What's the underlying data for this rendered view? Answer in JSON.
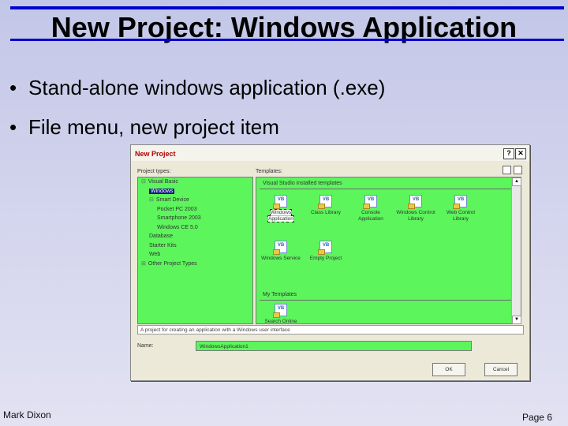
{
  "slide": {
    "title": "New Project: Windows Application",
    "bullets": [
      "Stand-alone windows application (.exe)",
      "File menu, new project item"
    ],
    "bullet_glyph": "•",
    "footer_left": "Mark Dixon",
    "footer_right": "Page 6",
    "accent_color": "#0000cc"
  },
  "dialog": {
    "title": "New Project",
    "help_glyph": "?",
    "close_glyph": "✕",
    "project_types_label": "Project types:",
    "templates_label": "Templates:",
    "tree": [
      {
        "glyph": "⊟",
        "label": "Visual Basic",
        "level": 0
      },
      {
        "glyph": "",
        "label": "Windows",
        "level": 1,
        "selected": true
      },
      {
        "glyph": "⊟",
        "label": "Smart Device",
        "level": 1
      },
      {
        "glyph": "",
        "label": "Pocket PC 2003",
        "level": 2
      },
      {
        "glyph": "",
        "label": "Smartphone 2003",
        "level": 2
      },
      {
        "glyph": "",
        "label": "Windows CE 5.0",
        "level": 2
      },
      {
        "glyph": "",
        "label": "Database",
        "level": 1
      },
      {
        "glyph": "",
        "label": "Starter Kits",
        "level": 1
      },
      {
        "glyph": "",
        "label": "Web",
        "level": 1
      },
      {
        "glyph": "⊞",
        "label": "Other Project Types",
        "level": 0
      }
    ],
    "installed_label": "Visual Studio installed templates",
    "installed_templates": [
      {
        "name": "Windows Application",
        "icon": "windows-application-icon",
        "selected": true
      },
      {
        "name": "Class Library",
        "icon": "class-library-icon"
      },
      {
        "name": "Console Application",
        "icon": "console-application-icon"
      },
      {
        "name": "Windows Control Library",
        "icon": "windows-control-library-icon"
      },
      {
        "name": "Web Control Library",
        "icon": "web-control-library-icon"
      },
      {
        "name": "Windows Service",
        "icon": "windows-service-icon"
      },
      {
        "name": "Empty Project",
        "icon": "empty-project-icon"
      }
    ],
    "my_templates_label": "My Templates",
    "my_templates": [
      {
        "name": "Search Online Templates...",
        "icon": "search-online-templates-icon"
      }
    ],
    "description": "A project for creating an application with a Windows user interface",
    "name_label": "Name:",
    "name_value": "WindowsApplication1",
    "ok_label": "OK",
    "cancel_label": "Cancel",
    "pane_color": "#5cf55c"
  }
}
